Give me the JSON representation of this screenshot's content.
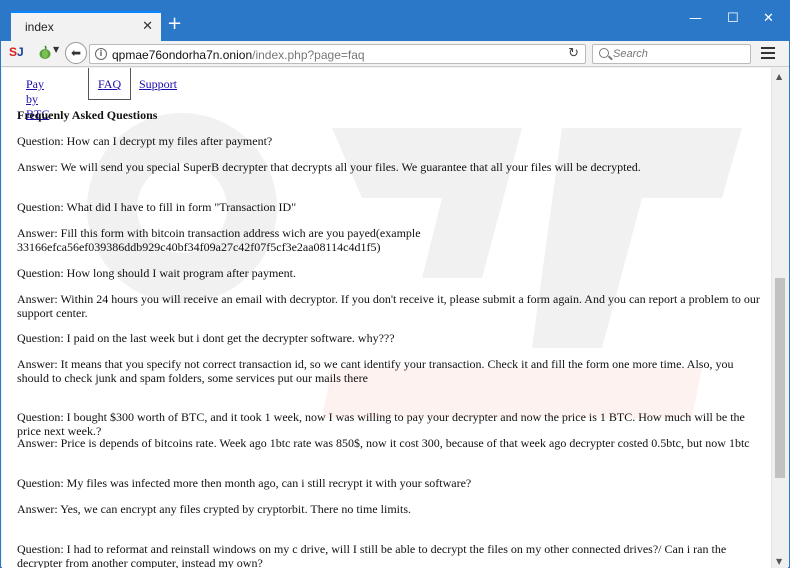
{
  "browser": {
    "tab_title": "index",
    "tab_close": "✕",
    "new_tab": "+",
    "minimize": "—",
    "maximize": "☐",
    "close": "✕",
    "extension_logo_s": "S",
    "extension_logo_j": "J",
    "url_host": "qpmae76ondorha7n.onion",
    "url_path": "/index.php?page=faq",
    "search_placeholder": "Search",
    "accent_color": "#2b78c8"
  },
  "nav": {
    "items": [
      {
        "label": "Pay by BTC"
      },
      {
        "label": "FAQ"
      },
      {
        "label": "Support"
      }
    ]
  },
  "faq": {
    "title": "Frequenly Asked Questions",
    "items": [
      {
        "q": "Question: How can I decrypt my files after payment?",
        "a": "Answer: We will send you special SuperB decrypter that decrypts all your files. We guarantee that all your files will be decrypted."
      },
      {
        "q": "Question: What did I have to fill in form \"Transaction ID\"",
        "a": "Answer: Fill this form with bitcoin transaction address wich are you payed(example 33166efca56ef039386ddb929c40bf34f09a27c42f07f5cf3e2aa08114c4d1f5)"
      },
      {
        "q": "Question: How long should I wait program after payment.",
        "a": "Answer: Within 24 hours you will receive an email with decryptor. If you don't receive it, please submit a form again. And you can report a problem to our support center."
      },
      {
        "q": "Question: I paid on the last week but i dont get the decrypter software. why???",
        "a": "Answer: It means that you specify not correct transaction id, so we cant identify your transaction. Check it and fill the form one more time. Also, you should to check junk and spam folders, some services put our mails there"
      },
      {
        "q": "Question: I bought $300 worth of BTC, and it took 1 week, now I was willing to pay your decrypter and now the price is 1 BTC. How much will be the price next week.?",
        "a": "Answer: Price is depends of bitcoins rate. Week ago 1btc rate was 850$, now it cost 300, because of that week ago decrypter costed 0.5btc, but now 1btc"
      },
      {
        "q": "Question: My files was infected more then month ago, can i still recrypt it with your software?",
        "a": "Answer: Yes, we can encrypt any files crypted by cryptorbit. There no time limits."
      },
      {
        "q": "Question: I had to reformat and reinstall windows on my c drive, will I still be able to decrypt the files on my other connected drives?/ Can i ran the decrypter from another computer, instead my own?",
        "a": ""
      }
    ]
  }
}
